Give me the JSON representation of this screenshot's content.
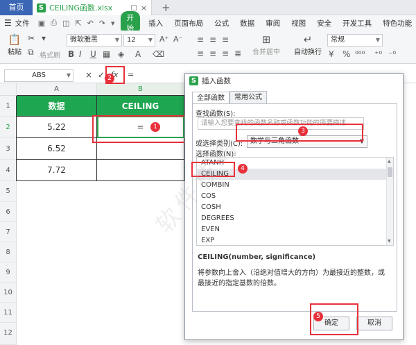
{
  "tabs": {
    "home": "首页",
    "file": "CEILING函数.xlsx",
    "add": "+"
  },
  "menu": {
    "file": "文件",
    "start": "开始",
    "items": [
      "插入",
      "页面布局",
      "公式",
      "数据",
      "审阅",
      "视图",
      "安全",
      "开发工具",
      "特色功能"
    ]
  },
  "ribbon": {
    "paste": "粘贴",
    "format_painter": "格式刷",
    "font": "微软雅黑",
    "font_size": "12",
    "merge": "合并居中",
    "wrap": "自动换行",
    "number_format": "常规"
  },
  "formula_bar": {
    "name_box": "ABS",
    "cancel": "×",
    "confirm": "✓",
    "fx": "fx",
    "value": "="
  },
  "sheet": {
    "columns": [
      "A",
      "B"
    ],
    "rows": [
      "1",
      "2",
      "3",
      "4",
      "5",
      "6",
      "7",
      "8",
      "9",
      "10",
      "11",
      "12"
    ],
    "header_a": "数据",
    "header_b": "CEILING",
    "values": [
      "5.22",
      "6.52",
      "7.72"
    ],
    "b2": "="
  },
  "dialog": {
    "title": "插入函数",
    "tab_all": "全部函数",
    "tab_common": "常用公式",
    "search_label": "查找函数(S):",
    "search_placeholder": "请输入您要查找的函数名称或函数功能的简要描述...",
    "category_label": "或选择类别(C):",
    "category_value": "数学与三角函数",
    "select_label": "选择函数(N):",
    "functions": [
      "ATANH",
      "CEILING",
      "COMBIN",
      "COS",
      "COSH",
      "DEGREES",
      "EVEN",
      "EXP"
    ],
    "selected": "CEILING",
    "signature": "CEILING(number, significance)",
    "description": "将参数向上舍入（沿绝对值增大的方向）为最接近的整数，或最接近的指定基数的倍数。",
    "ok": "确定",
    "cancel": "取消"
  },
  "annotations": [
    "1",
    "2",
    "3",
    "4",
    "5"
  ],
  "colors": {
    "accent_green": "#2aa14b",
    "header_green": "#1fa650",
    "home_tab_blue": "#3a66b5",
    "annotation_red": "#e8303a"
  }
}
